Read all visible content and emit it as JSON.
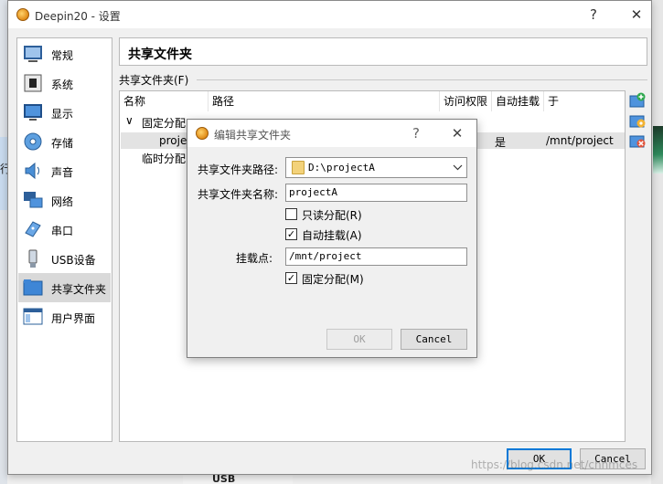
{
  "window": {
    "title": "Deepin20 - 设置",
    "help_glyph": "?",
    "close_glyph": "✕"
  },
  "sidebar": {
    "items": [
      {
        "label": "常规",
        "icon": "general-icon"
      },
      {
        "label": "系统",
        "icon": "system-chip-icon"
      },
      {
        "label": "显示",
        "icon": "display-monitor-icon"
      },
      {
        "label": "存储",
        "icon": "storage-disk-icon"
      },
      {
        "label": "声音",
        "icon": "speaker-icon"
      },
      {
        "label": "网络",
        "icon": "network-icon"
      },
      {
        "label": "串口",
        "icon": "serial-port-icon"
      },
      {
        "label": "USB设备",
        "icon": "usb-icon"
      },
      {
        "label": "共享文件夹",
        "icon": "shared-folder-icon"
      },
      {
        "label": "用户界面",
        "icon": "user-interface-icon"
      }
    ],
    "selected": "共享文件夹"
  },
  "section": {
    "title": "共享文件夹",
    "group_label": "共享文件夹(F)"
  },
  "table": {
    "columns": [
      "名称",
      "路径",
      "访问权限",
      "自动挂载",
      "于"
    ],
    "tree_arrow": "∨",
    "groups": [
      {
        "label": "固定分配",
        "rows": [
          {
            "name": "proje",
            "auto_mount": "是",
            "mount_point": "/mnt/project"
          }
        ]
      },
      {
        "label": "临时分配",
        "rows": []
      }
    ]
  },
  "side_tools": [
    "add-share-icon",
    "edit-share-icon",
    "remove-share-icon"
  ],
  "buttons": {
    "ok": "OK",
    "cancel": "Cancel"
  },
  "modal": {
    "title": "编辑共享文件夹",
    "help_glyph": "?",
    "close_glyph": "✕",
    "path_label": "共享文件夹路径:",
    "path_value": "D:\\projectA",
    "name_label": "共享文件夹名称:",
    "name_value": "projectA",
    "readonly_label": "只读分配(R)",
    "readonly_checked": false,
    "automount_label": "自动挂载(A)",
    "automount_checked": true,
    "mountpoint_label": "挂载点:",
    "mountpoint_value": "/mnt/project",
    "permanent_label": "固定分配(M)",
    "permanent_checked": true,
    "ok": "OK",
    "cancel": "Cancel",
    "check_glyph": "✓"
  },
  "background": {
    "left_text": "行",
    "bottom_text": "USB"
  },
  "watermark": "https://blog.csdn.net/chnmces"
}
